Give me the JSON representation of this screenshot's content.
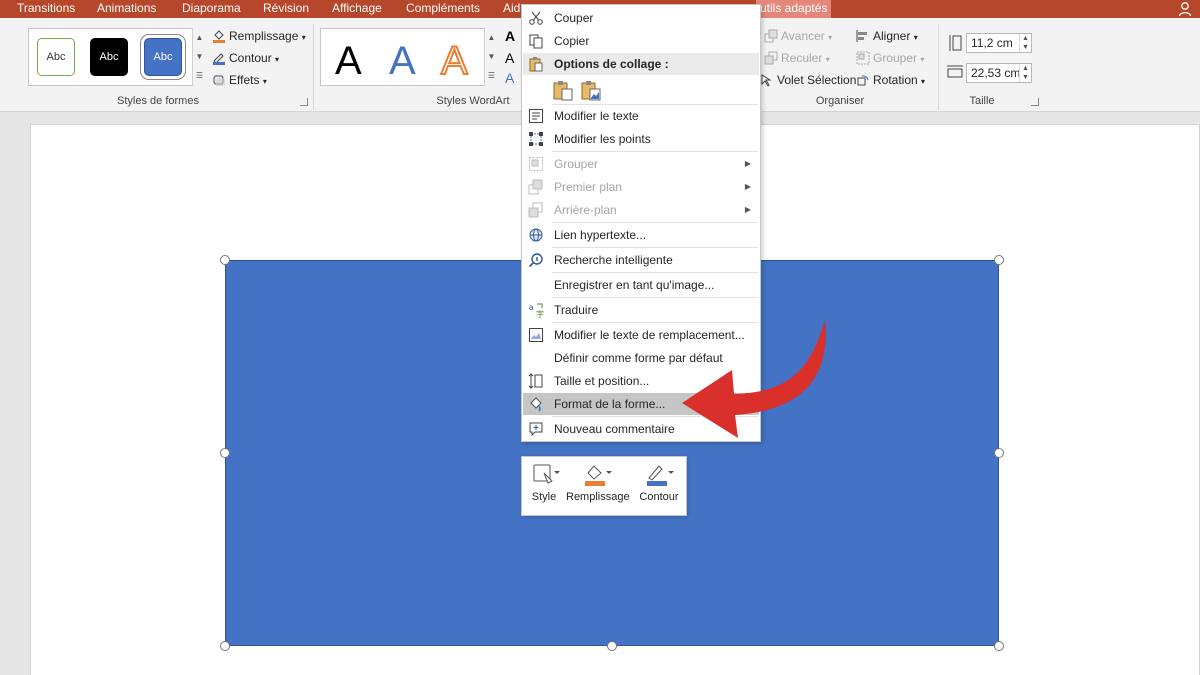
{
  "tabs": [
    {
      "label": "Transitions",
      "highlight": false
    },
    {
      "label": "Animations",
      "highlight": false
    },
    {
      "label": "Diaporama",
      "highlight": false
    },
    {
      "label": "Révision",
      "highlight": false
    },
    {
      "label": "Affichage",
      "highlight": false
    },
    {
      "label": "Compléments",
      "highlight": false
    },
    {
      "label": "Aid",
      "highlight": false
    },
    {
      "label": "utils adaptés",
      "highlight": true
    }
  ],
  "ribbon": {
    "shape_styles": {
      "label": "Styles de formes",
      "samples": [
        "Abc",
        "Abc",
        "Abc"
      ],
      "fill": "Remplissage",
      "outline": "Contour",
      "effects": "Effets"
    },
    "wordart": {
      "label": "Styles WordArt",
      "letters": [
        "A",
        "A",
        "A"
      ]
    },
    "arrange": {
      "label": "Organiser",
      "forward": "Avancer",
      "backward": "Reculer",
      "selection_pane": "Volet Sélection",
      "align": "Aligner",
      "group": "Grouper",
      "rotate": "Rotation"
    },
    "size": {
      "label": "Taille",
      "height": "11,2 cm",
      "width": "22,53 cm"
    }
  },
  "context_menu": {
    "cut": "Couper",
    "copy": "Copier",
    "paste_options": "Options de collage :",
    "edit_text": "Modifier le texte",
    "edit_points": "Modifier les points",
    "group": "Grouper",
    "bring_front": "Premier plan",
    "send_back": "Arrière-plan",
    "hyperlink": "Lien hypertexte...",
    "smart_lookup": "Recherche intelligente",
    "save_as_picture": "Enregistrer en tant qu'image...",
    "translate": "Traduire",
    "edit_alt_text": "Modifier le texte de remplacement...",
    "set_default": "Définir comme forme par défaut",
    "size_position": "Taille et position...",
    "format_shape": "Format de la forme...",
    "new_comment": "Nouveau commentaire"
  },
  "mini_toolbar": {
    "style": "Style",
    "fill": "Remplissage",
    "outline": "Contour"
  },
  "colors": {
    "accent": "#b7472a",
    "shape_fill": "#4472c4",
    "arrow": "#d9302c",
    "fill_orange": "#ed7d31"
  }
}
